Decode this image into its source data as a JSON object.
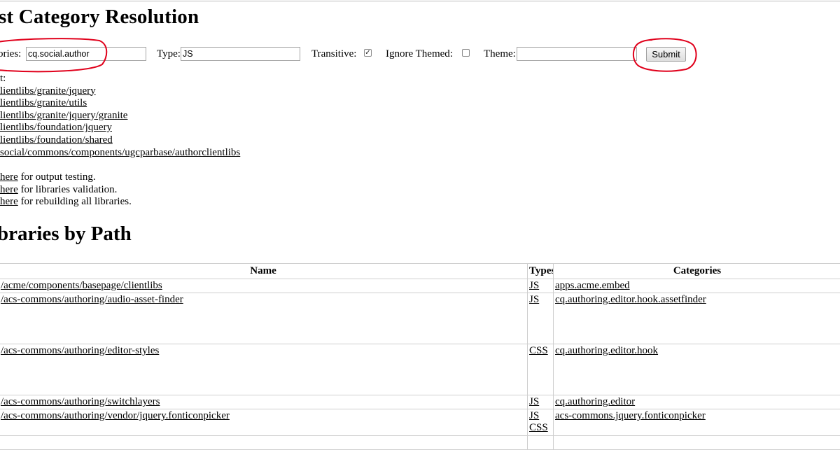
{
  "headings": {
    "resolution": "st Category Resolution",
    "by_path": "braries by Path"
  },
  "form": {
    "categories_label": "ories:",
    "categories_value": "cq.social.author",
    "type_label": "Type:",
    "type_value": "JS",
    "transitive_label": "Transitive:",
    "transitive_checked": true,
    "ignore_themed_label": "Ignore Themed:",
    "ignore_themed_checked": false,
    "theme_label": "Theme:",
    "theme_value": "",
    "submit_label": "Submit"
  },
  "result": {
    "label": "t:",
    "items": [
      "lientlibs/granite/jquery",
      "lientlibs/granite/utils",
      "lientlibs/granite/jquery/granite",
      "lientlibs/foundation/jquery",
      "lientlibs/foundation/shared",
      "social/commons/components/ugcparbase/authorclientlibs"
    ]
  },
  "info": [
    {
      "link": "here",
      "text": " for output testing."
    },
    {
      "link": "here",
      "text": " for libraries validation."
    },
    {
      "link": "here",
      "text": " for rebuilding all libraries."
    }
  ],
  "table": {
    "headers": {
      "name": "Name",
      "types": "Types",
      "categories": "Categories"
    },
    "rows": [
      {
        "name": "/acme/components/basepage/clientlibs",
        "types": [
          "JS"
        ],
        "categories": "apps.acme.embed"
      },
      {
        "name": "/acs-commons/authoring/audio-asset-finder",
        "types": [
          "JS"
        ],
        "categories": "cq.authoring.editor.hook.assetfinder"
      },
      {
        "name": "/acs-commons/authoring/editor-styles",
        "types": [
          "CSS"
        ],
        "categories": "cq.authoring.editor.hook"
      },
      {
        "name": "/acs-commons/authoring/switchlayers",
        "types": [
          "JS"
        ],
        "categories": "cq.authoring.editor"
      },
      {
        "name": "/acs-commons/authoring/vendor/jquery.fonticonpicker",
        "types": [
          "JS",
          "CSS"
        ],
        "categories": "acs-commons.jquery.fonticonpicker"
      }
    ]
  },
  "annotation_color": "#e0001b"
}
